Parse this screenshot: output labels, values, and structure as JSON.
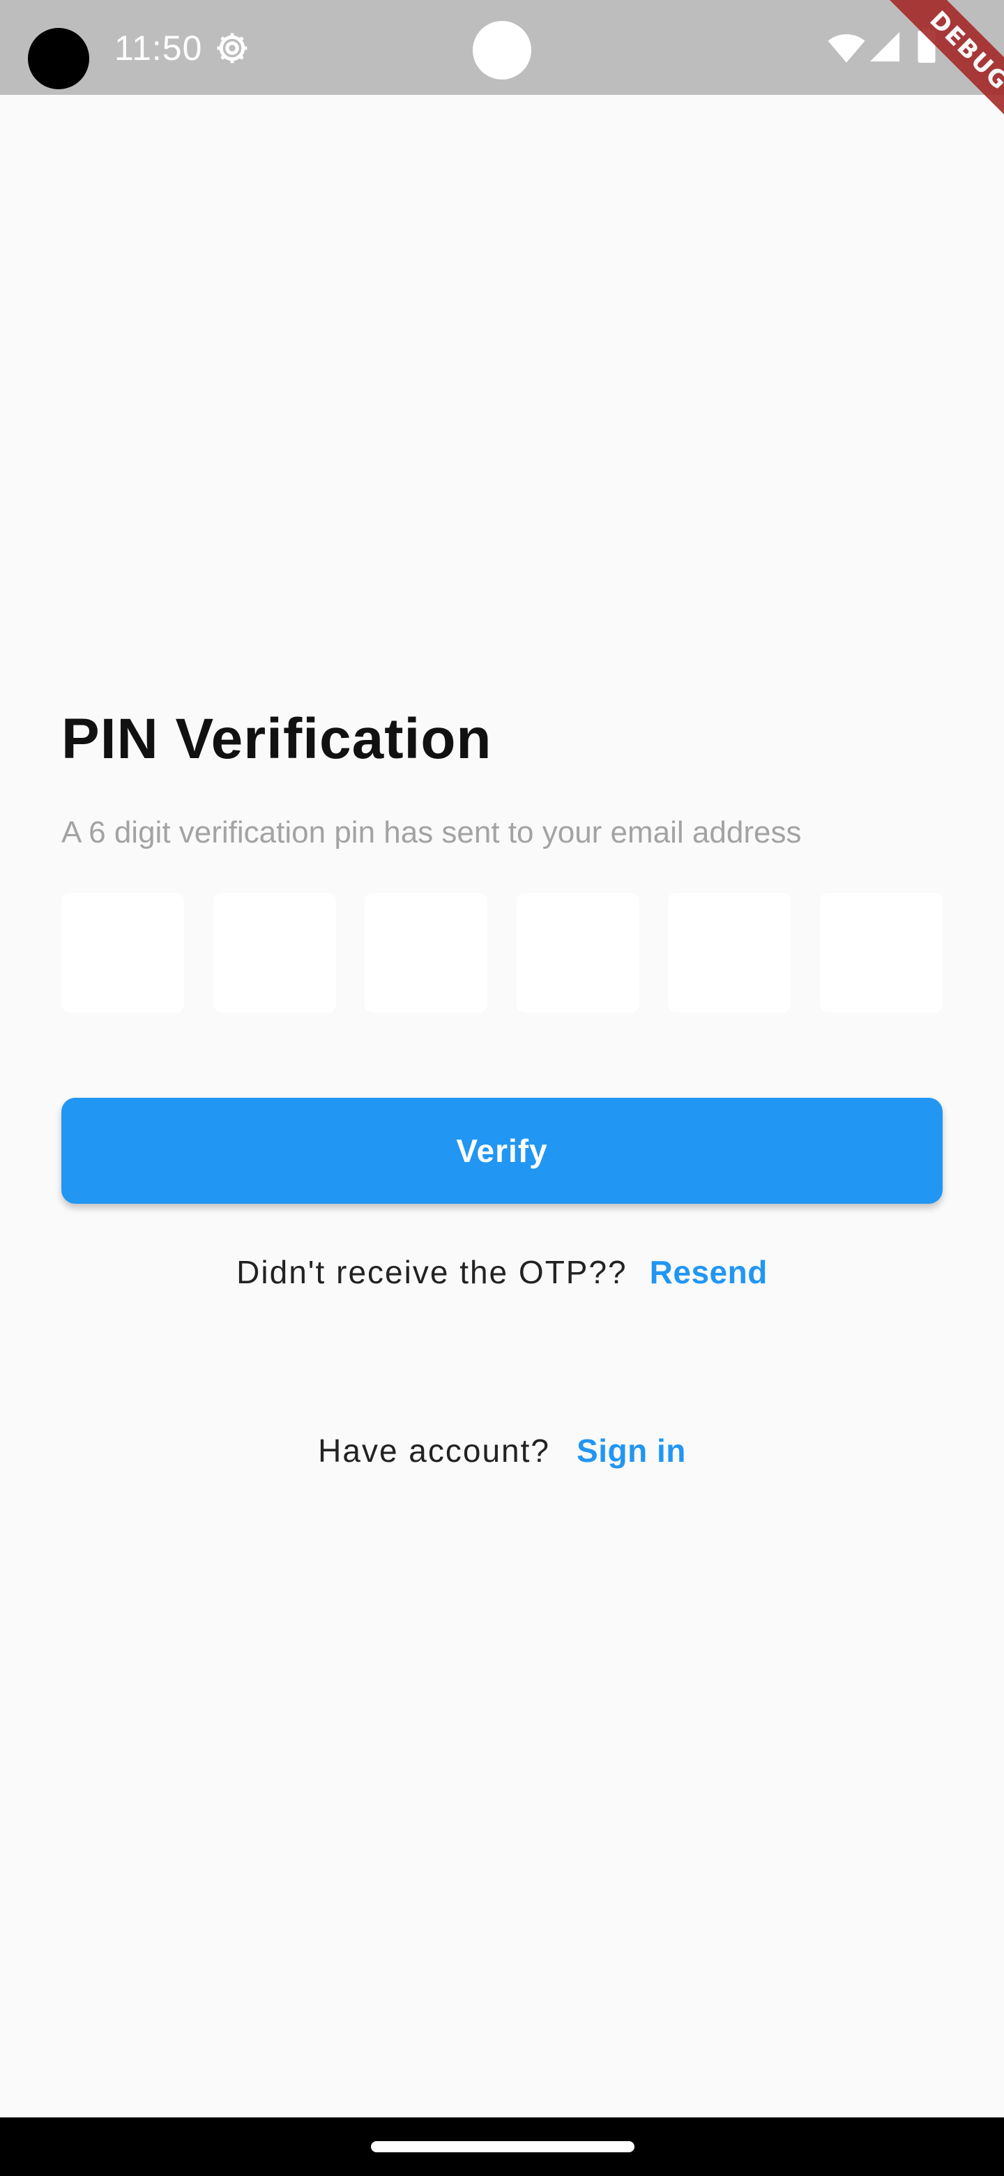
{
  "status_bar": {
    "time": "11:50"
  },
  "debug_banner": {
    "label": "DEBUG"
  },
  "main": {
    "title": "PIN Verification",
    "subtitle": "A 6 digit verification pin has sent to your email address",
    "pin_fields": [
      "",
      "",
      "",
      "",
      "",
      ""
    ],
    "verify_label": "Verify",
    "resend_prompt": "Didn't receive the OTP??",
    "resend_label": "Resend",
    "signin_prompt": "Have account?",
    "signin_label": "Sign in"
  },
  "icons": {
    "settings": "gear-icon",
    "wifi": "wifi-icon",
    "signal": "cell-signal-icon",
    "battery": "battery-icon"
  },
  "colors": {
    "accent": "#2196f3",
    "background": "#fafafa",
    "status_bar": "#bdbdbd",
    "subtitle_text": "#a3a3a3",
    "debug_ribbon": "#a52a2a"
  }
}
